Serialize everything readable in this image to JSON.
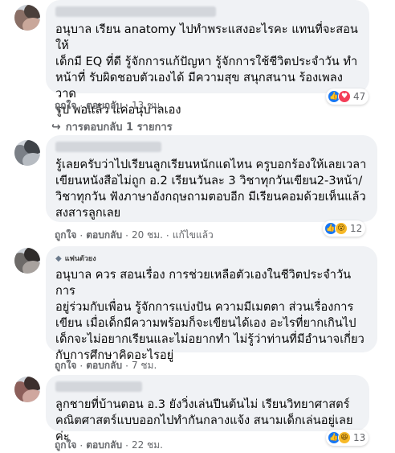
{
  "comments": [
    {
      "text": "อนุบาล เรียน anatomy ไปทำพระแสงอะไรคะ แทนที่จะสอนให้\nเด็กมี EQ ที่ดี รู้จักการแก้ปัญหา รู้จักการใช้ชีวิตประจำวัน ทำ\nหน้าที่ รับผิดชอบตัวเองได้ มีความสุข สนุกสนาน ร้องเพลง วาด\nรูป พอแล้ว แค่อนุบาลเอง",
      "like_label": "ถูกใจ",
      "reply_label": "ตอบกลับ",
      "time": "13 ชม.",
      "edited": "",
      "reactions": [
        "like-icon",
        "love-icon"
      ],
      "reaction_count": "47"
    },
    {
      "text": "รู้เลยครับว่าไปเรียนลูกเรียนหนักแดไหน ครูบอกร้องให้เลยเวลา\nเขียนหนังสือไม่ถูก อ.2 เรียนวันละ 3 วิชาทุกวันเขียน2-3หน้า/\nวิชาทุกวัน ฟังภาษาอังกฤษถามตอบอีก มีเรียนคอมด้วยเห็นแล้ว\nสงสารลูกเลย",
      "like_label": "ถูกใจ",
      "reply_label": "ตอบกลับ",
      "time": "20 ชม.",
      "edited": "แก้ไขแล้ว",
      "reactions": [
        "like-icon",
        "wow-icon"
      ],
      "reaction_count": "12"
    },
    {
      "badge": "แฟนตัวยง",
      "text": "อนุบาล ควร สอนเรื่อง การช่วยเหลือตัวเองในชีวิตประจำวัน การ\nอยู่ร่วมกับเพื่อน รู้จักการแบ่งปัน ความมีเมตตา ส่วนเรื่องการ\nเขียน เมื่อเด็กมีความพร้อมก็จะเขียนได้เอง อะไรที่ยากเกินไป\nเด็กจะไม่อยากเรียนและไม่อยากทำ ไม่รู้ว่าท่านที่มีอำนาจเกี่ยว\nกับการศึกษาคิดอะไรอยู่",
      "like_label": "ถูกใจ",
      "reply_label": "ตอบกลับ",
      "time": "7 ชม.",
      "edited": ""
    },
    {
      "text": "ลูกชายที่บ้านตอน อ.3 ยังวิ่งเล่นปีนต้นไม่ เรียนวิทยาศาสตร์\nคณิตศาสตร์แบบออกไปทำกันกลางแจ้ง สนามเด็กเล่นอยู่เลยค่ะ",
      "like_label": "ถูกใจ",
      "reply_label": "ตอบกลับ",
      "time": "22 ชม.",
      "edited": "",
      "reactions": [
        "like-icon",
        "haha-icon"
      ],
      "reaction_count": "13"
    }
  ],
  "replies_link": "การตอบกลับ 1 รายการ",
  "separator": "·",
  "colors": {
    "bubble": "#f0f2f5",
    "meta": "#65676b",
    "like": "#1877f2",
    "love": "#f33e58",
    "haha": "#f7b928"
  }
}
